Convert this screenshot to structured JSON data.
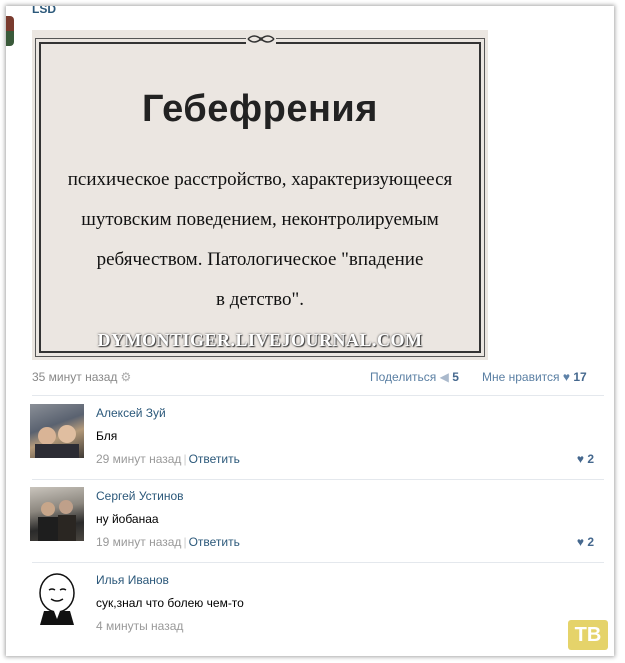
{
  "post": {
    "author": "LSD",
    "image": {
      "term": "Гебефрения",
      "definition_lines": [
        "психическое расстройство, характеризующееся",
        "шутовским поведением, неконтролируемым",
        "ребячеством. Патологическое \"впадение",
        "в детство\"."
      ],
      "watermark": "DYMONTIGER.LIVEJOURNAL.COM"
    },
    "time": "35 минут назад",
    "share_label": "Поделиться",
    "share_count": "5",
    "like_label": "Мне нравится",
    "like_count": "17"
  },
  "comments": [
    {
      "name": "Алексей Зуй",
      "text": "Бля",
      "time": "29 минут назад",
      "reply": "Ответить",
      "likes": "2"
    },
    {
      "name": "Сергей Устинов",
      "text": "ну йобанаа",
      "time": "19 минут назад",
      "reply": "Ответить",
      "likes": "2"
    },
    {
      "name": "Илья Иванов",
      "text": "сук,знал что болею чем-то",
      "time": "4 минуты назад"
    }
  ],
  "badge": "ТВ",
  "colors": {
    "link": "#2b587a",
    "accent": "#45688e",
    "muted": "#999999"
  },
  "icons": {
    "settings": "gear-icon",
    "share": "megaphone-icon",
    "like": "heart-icon"
  }
}
